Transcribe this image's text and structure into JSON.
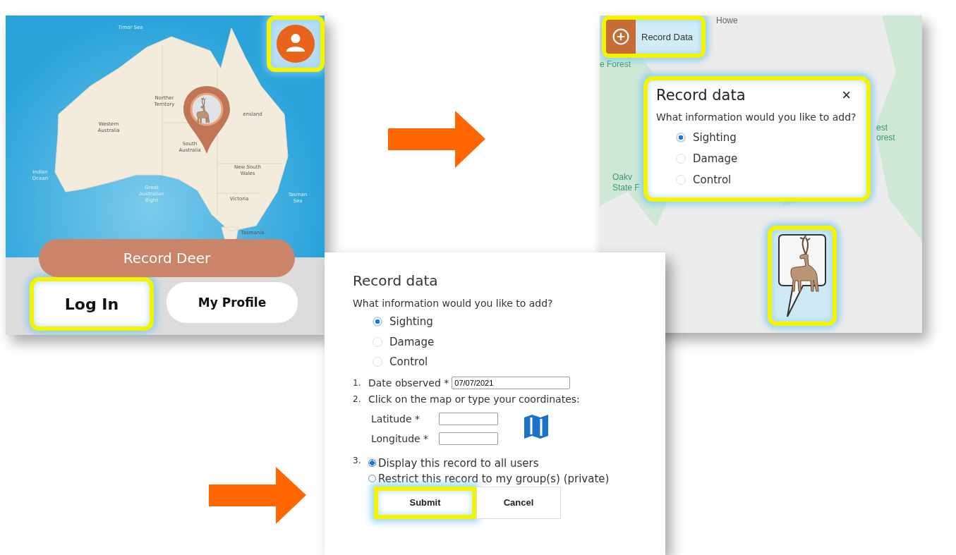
{
  "app_screen": {
    "map_labels": [
      {
        "text": "Timor Sea",
        "kind": "sea"
      },
      {
        "text": "Norther Territory",
        "kind": "land"
      },
      {
        "text": "Western Australia",
        "kind": "land"
      },
      {
        "text": "South Australia",
        "kind": "land"
      },
      {
        "text": "ensland",
        "kind": "land"
      },
      {
        "text": "New South Wales",
        "kind": "land"
      },
      {
        "text": "Victoria",
        "kind": "land"
      },
      {
        "text": "Indian Ocean",
        "kind": "sea"
      },
      {
        "text": "Great Australian Bight",
        "kind": "sea"
      },
      {
        "text": "Tasman Sea",
        "kind": "sea"
      },
      {
        "text": "Tasmania",
        "kind": "land"
      }
    ],
    "profile_button": {
      "highlighted": true
    },
    "record_button": {
      "label": "Record Deer",
      "highlighted": false
    },
    "buttons": [
      {
        "label": "Log In",
        "highlighted": true
      },
      {
        "label": "My Profile",
        "highlighted": false
      }
    ]
  },
  "map_screen": {
    "record_button": {
      "label": "Record Data",
      "highlighted": true
    },
    "map_labels": [
      {
        "text": "Howe"
      },
      {
        "text": "e Forest"
      },
      {
        "text": "est"
      },
      {
        "text": "orest"
      },
      {
        "text": "Oakv"
      },
      {
        "text": "State F"
      }
    ],
    "dialog": {
      "title": "Record data",
      "close": "×",
      "question": "What information would you like to add?",
      "highlighted": true,
      "options": [
        {
          "label": "Sighting",
          "selected": true
        },
        {
          "label": "Damage",
          "selected": false
        },
        {
          "label": "Control",
          "selected": false
        }
      ]
    },
    "marker": {
      "highlighted": true
    }
  },
  "form_screen": {
    "title": "Record data",
    "question": "What information would you like to add?",
    "options": [
      {
        "label": "Sighting",
        "selected": true
      },
      {
        "label": "Damage",
        "selected": false
      },
      {
        "label": "Control",
        "selected": false
      }
    ],
    "date": {
      "number": "1.",
      "label": "Date observed *",
      "value": "07/07/2021"
    },
    "coords": {
      "number": "2.",
      "label": "Click on the map or type your coordinates:",
      "latitude": "Latitude *",
      "longitude": "Longitude *"
    },
    "visibility": {
      "number": "3.",
      "options": [
        {
          "label": "Display this record to all users",
          "selected": true
        },
        {
          "label": "Restrict this record to my group(s) (private)",
          "selected": false
        }
      ]
    },
    "buttons": [
      {
        "label": "Submit",
        "highlighted": true
      },
      {
        "label": "Cancel",
        "highlighted": false
      }
    ]
  }
}
